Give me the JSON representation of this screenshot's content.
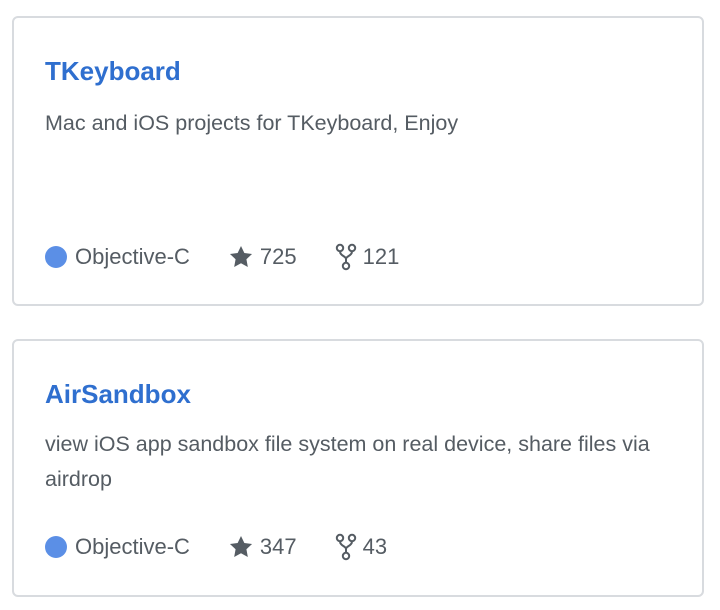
{
  "repos": [
    {
      "name": "TKeyboard",
      "description": "Mac and iOS projects for TKeyboard, Enjoy",
      "language": "Objective-C",
      "language_color": "#5b8fe6",
      "stars": "725",
      "forks": "121"
    },
    {
      "name": "AirSandbox",
      "description": "view iOS app sandbox file system on real device, share files via airdrop",
      "language": "Objective-C",
      "language_color": "#5b8fe6",
      "stars": "347",
      "forks": "43"
    }
  ],
  "icons": {
    "star": "star-icon",
    "fork": "fork-icon",
    "language": "language-color-dot"
  }
}
